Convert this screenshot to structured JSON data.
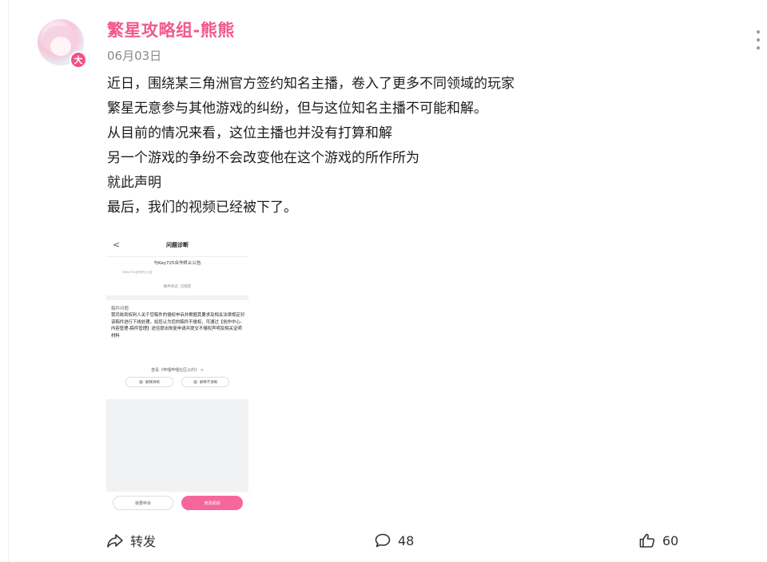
{
  "post": {
    "author": "繁星攻略组-熊熊",
    "avatar_badge": "大",
    "date": "06月03日",
    "lines": [
      "近日，围绕某三角洲官方签约知名主播，卷入了更多不同领域的玩家",
      "繁星无意参与其他游戏的纠纷，但与这位知名主播不可能和解。",
      "从目前的情况来看，这位主播也并没有打算和解",
      "另一个游戏的争纷不会改变他在这个游戏的所作所为",
      "就此声明",
      "最后，我们的视频已经被下了。"
    ]
  },
  "screenshot": {
    "back": "<",
    "title": "问题诊断",
    "notice": "与Key725合作终止公告",
    "small_text": "与Key725合作终止公告",
    "status": "稿件状态: 已锁定",
    "problem_title": "稿件问题",
    "problem_text": "我司收到权利人关于您稿件的侵权申诉并根据其要求及相关法律规定对该稿件进行下线处理。如您认为您的稿件不侵权，可通过【创作中心-内容管理-稿件管理】途径提出恢复申请并提交不侵权声明及相关证明材料",
    "link": "查看《哔哩哔哩社区公约》 >",
    "pill_a": "解释清晰",
    "pill_b": "解释不清晰",
    "btn_left": "我要申诉",
    "btn_right": "修改视频"
  },
  "footer": {
    "share_label": "转发",
    "comment_count": "48",
    "like_count": "60"
  },
  "colors": {
    "accent": "#f2588f",
    "badge": "#f0508a",
    "pink_button": "#f5679a"
  }
}
